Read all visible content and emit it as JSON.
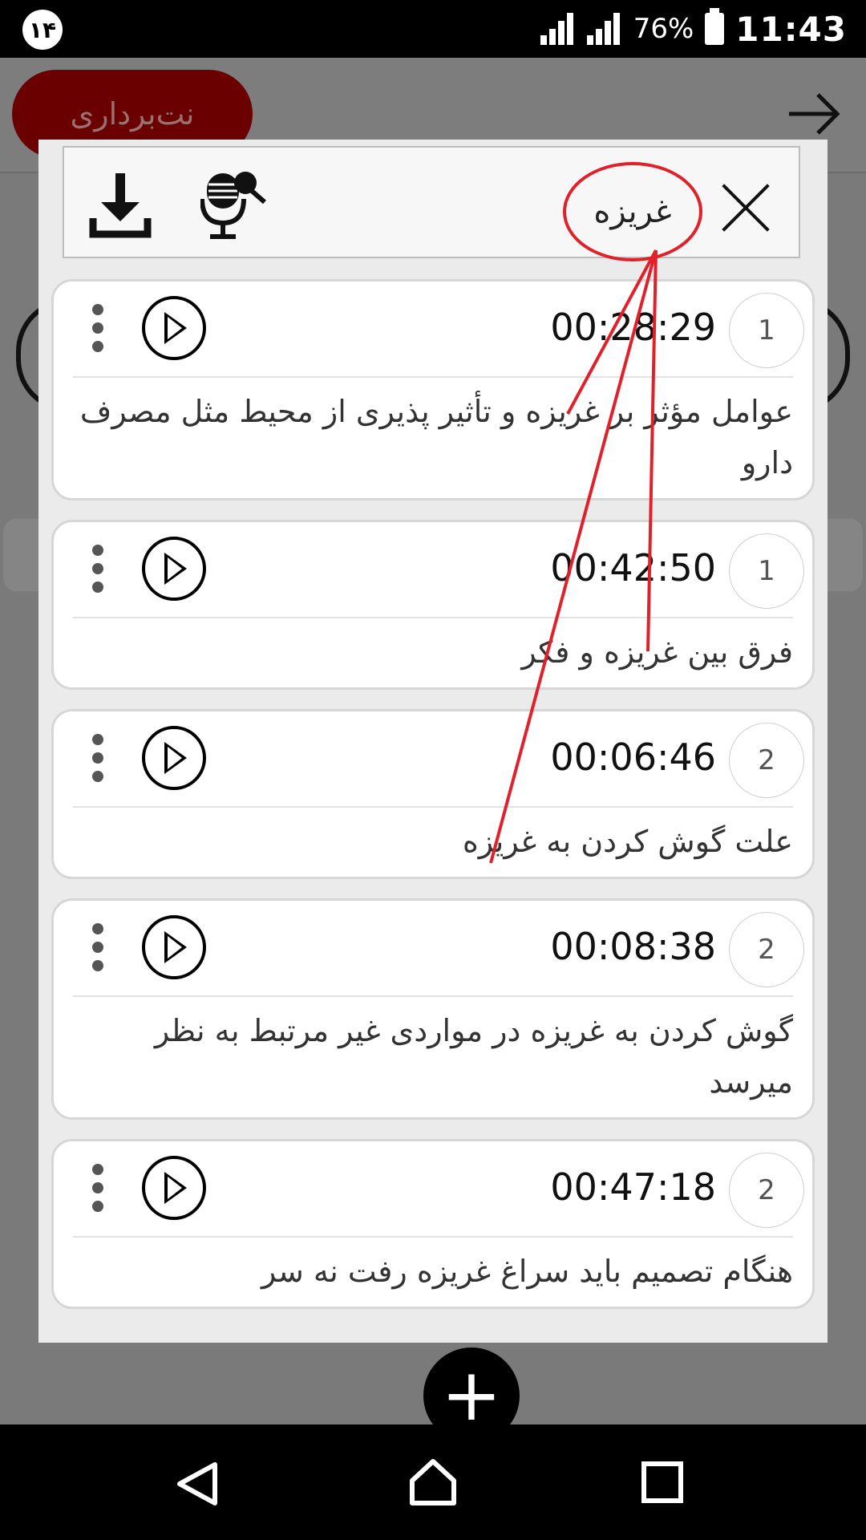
{
  "status_bar": {
    "notification_badge": "۱۴",
    "battery_percent": "76%",
    "time": "11:43"
  },
  "background_app": {
    "note_button_label": "نت‌برداری"
  },
  "dialog": {
    "search_term": "غریزه",
    "results": [
      {
        "number": "1",
        "time": "00:28:29",
        "text": "عوامل مؤثر بر غریزه و تأثیر پذیری از محیط مثل مصرف دارو"
      },
      {
        "number": "1",
        "time": "00:42:50",
        "text": "فرق بین غریزه و فکر"
      },
      {
        "number": "2",
        "time": "00:06:46",
        "text": "علت گوش کردن به غریزه"
      },
      {
        "number": "2",
        "time": "00:08:38",
        "text": "گوش کردن به غریزه در مواردی غیر مرتبط به نظر میرسد"
      },
      {
        "number": "2",
        "time": "00:47:18",
        "text": "هنگام تصمیم باید سراغ غریزه رفت نه سر"
      }
    ]
  },
  "fab": {
    "label": "+"
  },
  "colors": {
    "annotation": "#e0202a",
    "brand_dark_red": "#6b0000"
  }
}
